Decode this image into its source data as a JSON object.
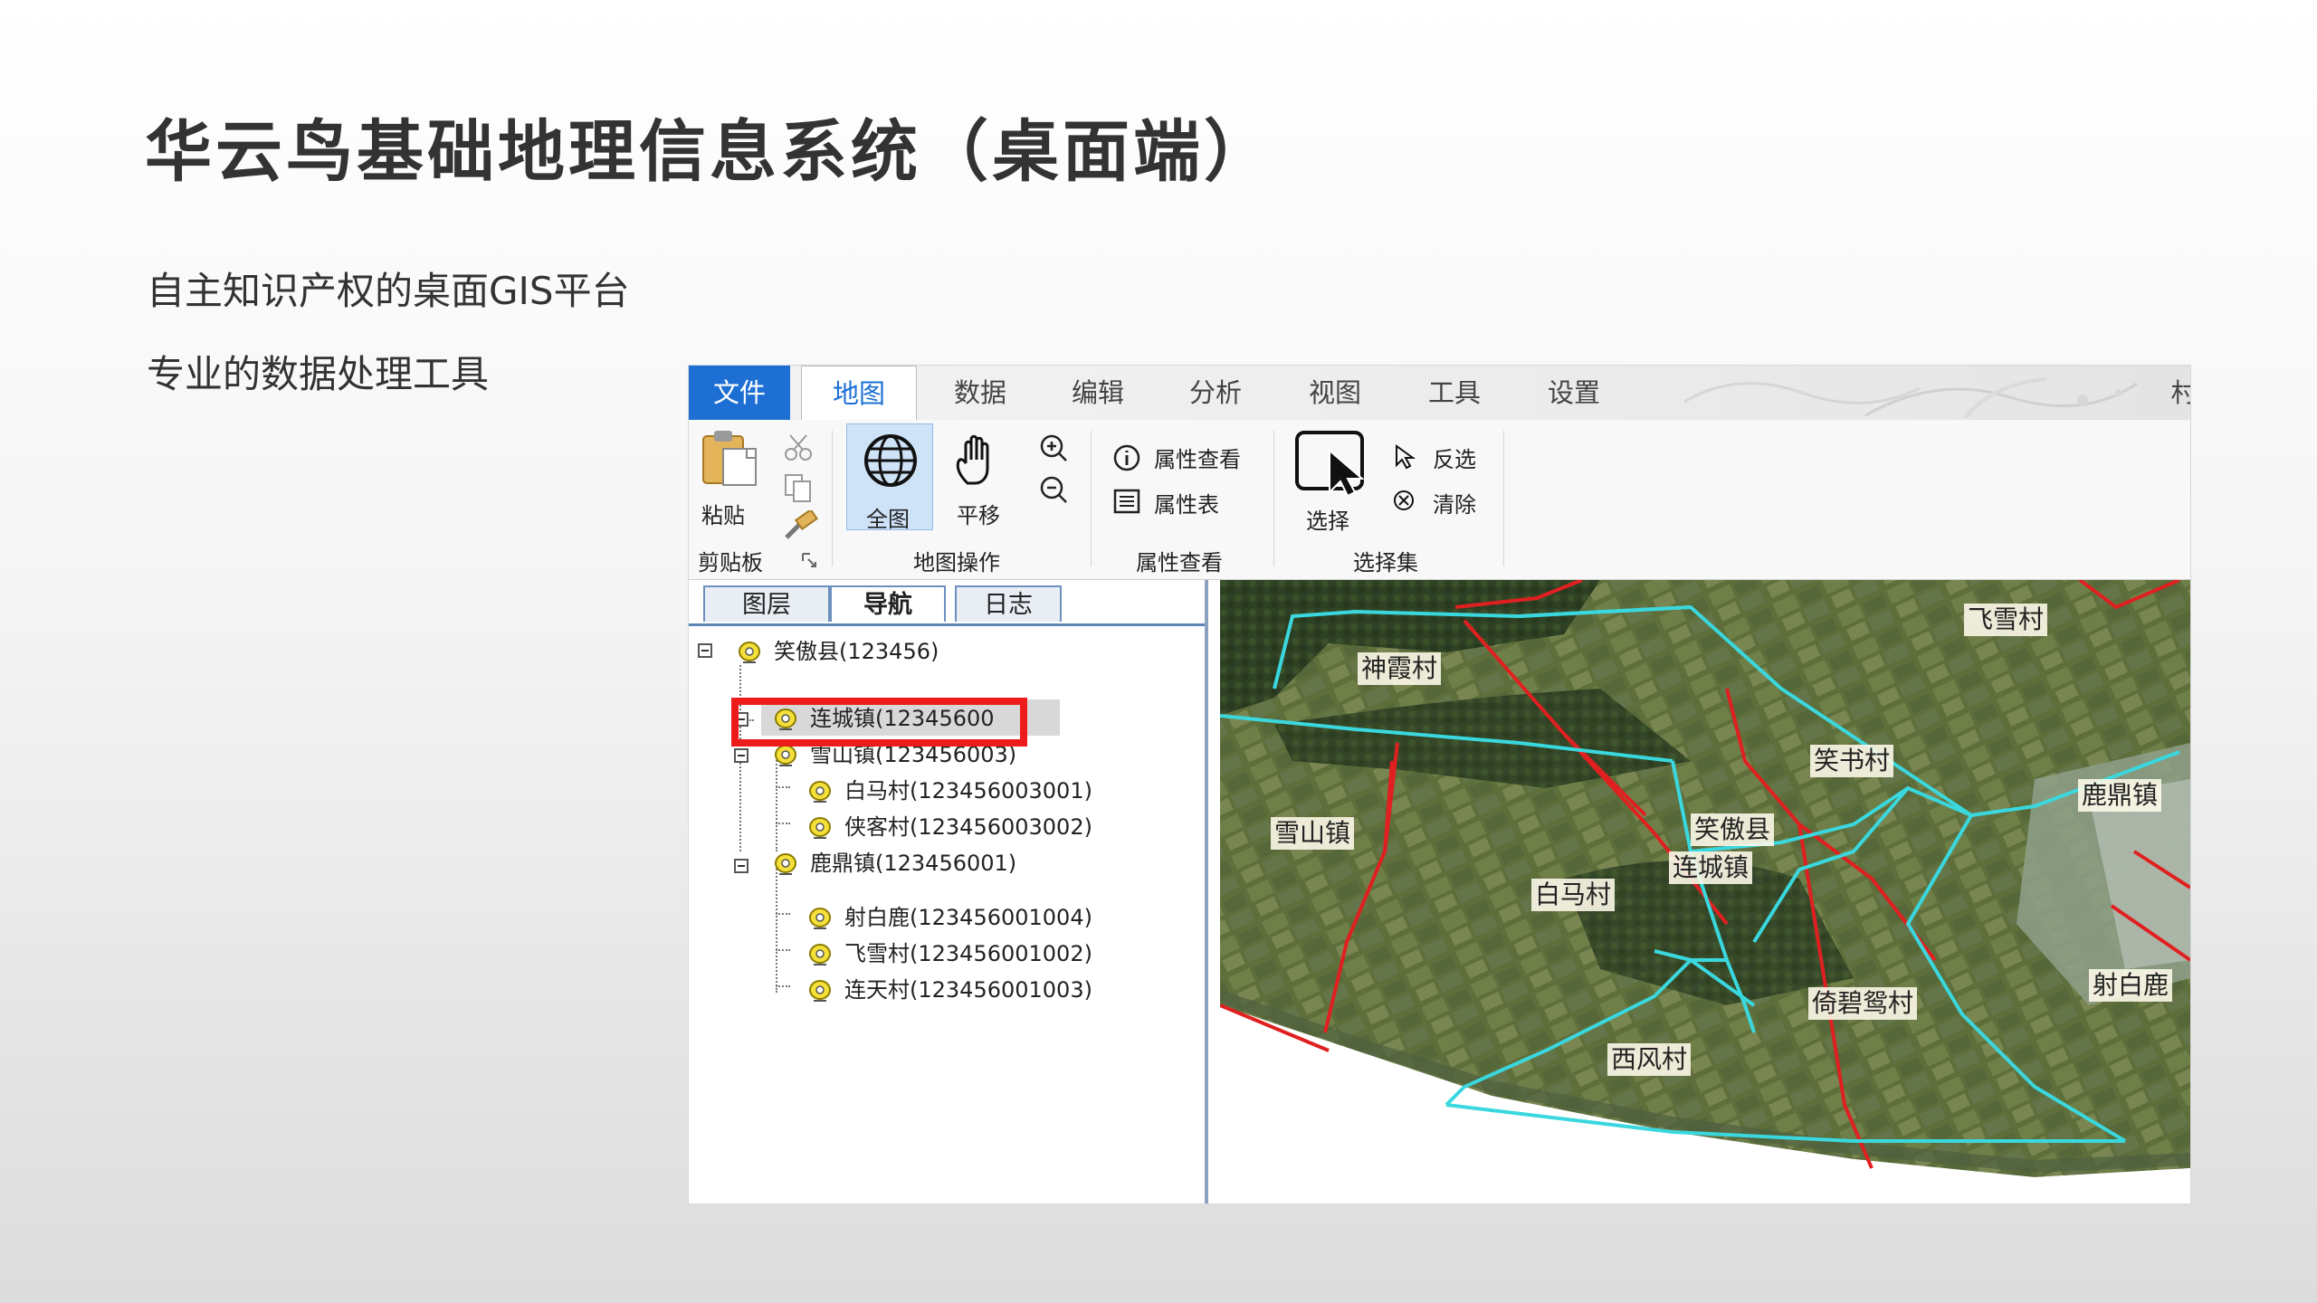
{
  "slide": {
    "title": "华云鸟基础地理信息系统（桌面端）",
    "subtitles": [
      "自主知识产权的桌面GIS平台",
      "专业的数据处理工具"
    ]
  },
  "app": {
    "tabs": [
      "文件",
      "地图",
      "数据",
      "编辑",
      "分析",
      "视图",
      "工具",
      "设置"
    ],
    "tab_overflow": "村",
    "active_tab": "地图",
    "ribbon": {
      "clipboard": {
        "paste": "粘贴",
        "group": "剪贴板"
      },
      "map_ops": {
        "full_extent": "全图",
        "pan": "平移",
        "group": "地图操作"
      },
      "attr_view": {
        "query": "属性查看",
        "table": "属性表",
        "group": "属性查看"
      },
      "selection": {
        "select": "选择",
        "invert": "反选",
        "clear": "清除",
        "group": "选择集"
      }
    },
    "panel_tabs": [
      "图层",
      "导航",
      "日志"
    ],
    "active_panel_tab": "导航",
    "tree": [
      {
        "label": "笑傲县(123456)"
      },
      {
        "label": "连城镇(12345600",
        "selected": true
      },
      {
        "label": "雪山镇(123456003)"
      },
      {
        "label": "白马村(123456003001)"
      },
      {
        "label": "侠客村(123456003002)"
      },
      {
        "label": "鹿鼎镇(123456001)"
      },
      {
        "label": "射白鹿(123456001004)"
      },
      {
        "label": "飞雪村(123456001002)"
      },
      {
        "label": "连天村(123456001003)"
      }
    ],
    "map_labels": [
      "神霞村",
      "飞雪村",
      "笑书村",
      "鹿鼎镇",
      "雪山镇",
      "笑傲县",
      "连城镇",
      "白马村",
      "射白鹿",
      "倚碧鸳村",
      "西风村"
    ],
    "colors": {
      "accent": "#1d6fd4",
      "village_boundary": "#3ad8de",
      "town_boundary": "#e02020",
      "highlight": "#ee1b1b"
    }
  }
}
